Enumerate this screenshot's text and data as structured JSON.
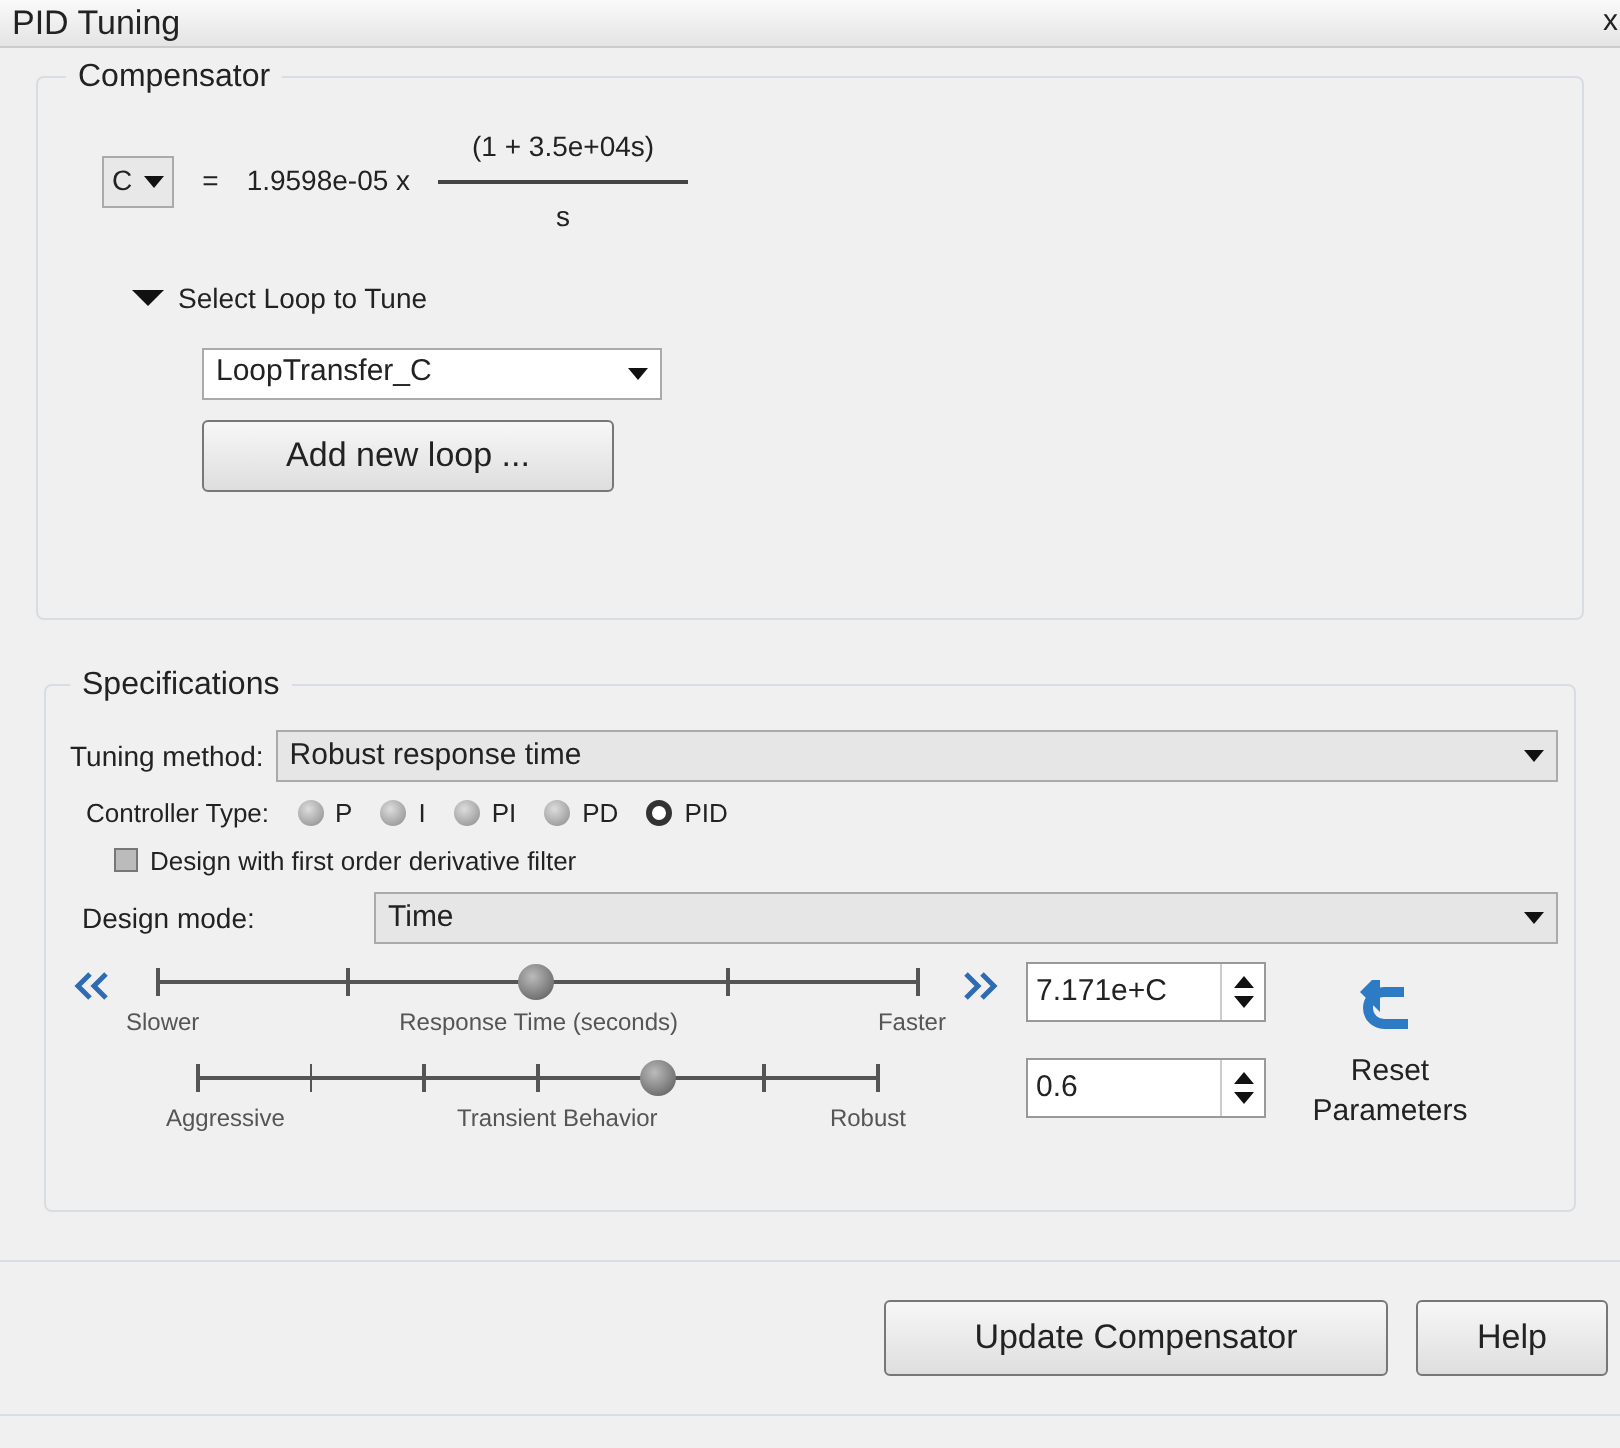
{
  "window": {
    "title": "PID Tuning",
    "close": "x"
  },
  "compensator": {
    "title": "Compensator",
    "selector": "C",
    "equals": "=",
    "gain": "1.9598e-05 x",
    "numerator": "(1 + 3.5e+04s)",
    "denominator": "s",
    "loop_section": {
      "label": "Select Loop to Tune",
      "expanded": true,
      "loop": "LoopTransfer_C",
      "add_button": "Add new loop ..."
    }
  },
  "specifications": {
    "title": "Specifications",
    "tuning_method_label": "Tuning method:",
    "tuning_method": "Robust response time",
    "controller_type_label": "Controller Type:",
    "controller_types": [
      {
        "label": "P",
        "selected": false
      },
      {
        "label": "I",
        "selected": false
      },
      {
        "label": "PI",
        "selected": false
      },
      {
        "label": "PD",
        "selected": false
      },
      {
        "label": "PID",
        "selected": true
      }
    ],
    "derivative_filter": {
      "label": "Design with first order derivative filter",
      "checked": false
    },
    "design_mode_label": "Design mode:",
    "design_mode": "Time",
    "sliders": [
      {
        "left": "Slower",
        "center": "Response Time (seconds)",
        "right": "Faster",
        "kind": "response",
        "level": 0.5,
        "value": "7.171e+C"
      },
      {
        "left": "Aggressive",
        "center": "Transient Behavior",
        "right": "Robust",
        "kind": "transient",
        "level": 0.68,
        "value": "0.6"
      }
    ],
    "reset_button": "Reset Parameters"
  },
  "buttons": [
    "Update Compensator",
    "Help"
  ]
}
